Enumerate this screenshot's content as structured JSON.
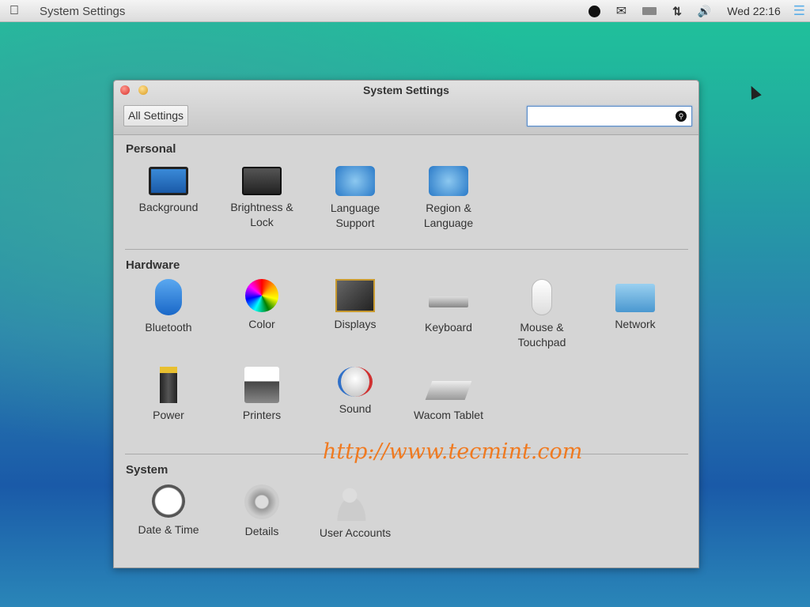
{
  "topbar": {
    "app_title": "System Settings",
    "clock": "Wed 22:16",
    "icons": [
      "apple-icon",
      "search-icon",
      "mail-icon",
      "battery-icon",
      "network-arrows-icon",
      "volume-icon",
      "menu-icon"
    ]
  },
  "window": {
    "title": "System Settings",
    "all_settings": "All Settings",
    "search_value": "",
    "colors": {
      "close": "#e0403a",
      "minimize": "#e8b030"
    }
  },
  "sections": [
    {
      "title": "Personal",
      "items": [
        {
          "label": "Background"
        },
        {
          "label": "Brightness &\nLock"
        },
        {
          "label": "Language\nSupport"
        },
        {
          "label": "Region &\nLanguage"
        }
      ]
    },
    {
      "title": "Hardware",
      "items": [
        {
          "label": "Bluetooth"
        },
        {
          "label": "Color"
        },
        {
          "label": "Displays"
        },
        {
          "label": "Keyboard"
        },
        {
          "label": "Mouse &\nTouchpad"
        },
        {
          "label": "Network"
        },
        {
          "label": "Power"
        },
        {
          "label": "Printers"
        },
        {
          "label": "Sound"
        },
        {
          "label": "Wacom Tablet"
        }
      ]
    },
    {
      "title": "System",
      "items": [
        {
          "label": "Date & Time"
        },
        {
          "label": "Details"
        },
        {
          "label": "User Accounts"
        }
      ]
    }
  ],
  "watermark": "http://www.tecmint.com"
}
